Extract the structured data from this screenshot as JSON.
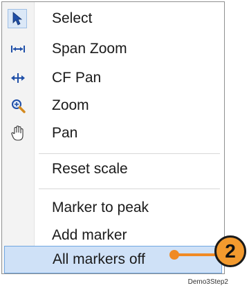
{
  "menu": {
    "items": [
      {
        "label": "Select",
        "icon": "pointer-arrow-icon",
        "checked": true
      },
      {
        "label": "Span Zoom",
        "icon": "span-zoom-icon"
      },
      {
        "label": "CF Pan",
        "icon": "cf-pan-icon"
      },
      {
        "label": "Zoom",
        "icon": "magnifier-icon"
      },
      {
        "label": "Pan",
        "icon": "hand-icon"
      },
      {
        "label": "Reset scale"
      },
      {
        "label": "Marker to peak"
      },
      {
        "label": "Add marker"
      },
      {
        "label": "All markers off",
        "highlighted": true
      }
    ]
  },
  "callout": {
    "number": "2"
  },
  "caption": "Demo3Step2",
  "colors": {
    "highlight": "#cfe1f7",
    "highlight_border": "#6fa6e1",
    "callout": "#f39a2e"
  }
}
